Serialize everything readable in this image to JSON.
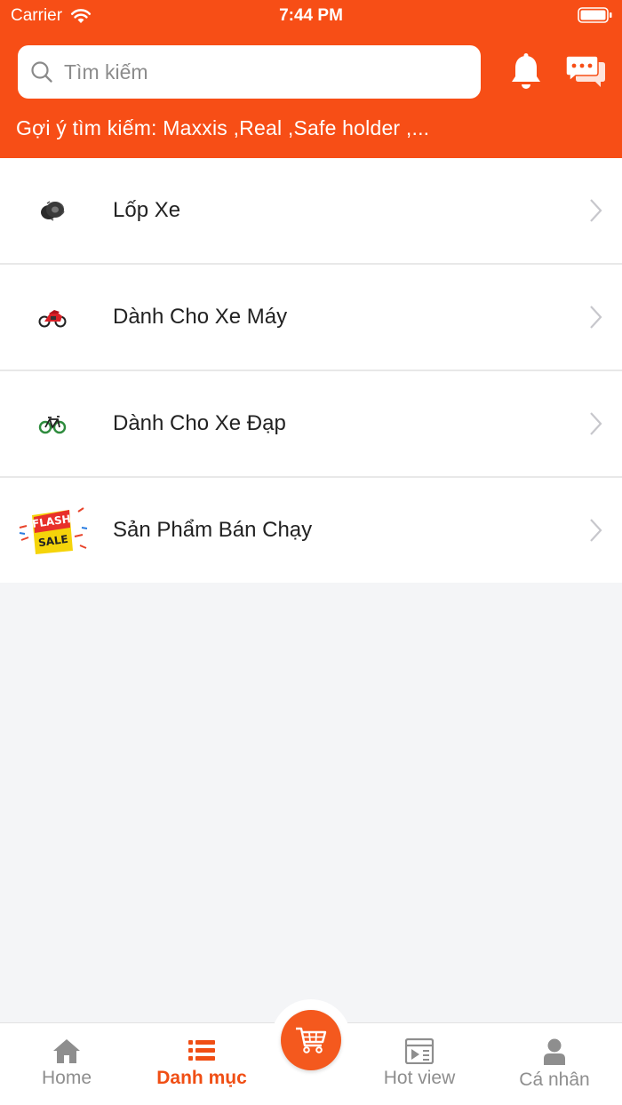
{
  "status_bar": {
    "carrier": "Carrier",
    "time": "7:44 PM"
  },
  "search": {
    "placeholder": "Tìm kiếm",
    "value": ""
  },
  "suggestions": {
    "text": "Gợi ý tìm kiếm: Maxxis ,Real ,Safe holder ,..."
  },
  "categories": [
    {
      "label": "Lốp Xe",
      "icon": "tire-icon"
    },
    {
      "label": "Dành Cho Xe Máy",
      "icon": "motorbike-icon"
    },
    {
      "label": "Dành Cho Xe Đạp",
      "icon": "bicycle-icon"
    },
    {
      "label": "Sản Phẩm Bán Chạy",
      "icon": "flash-sale-icon",
      "badge_line1": "FLASH",
      "badge_line2": "SALE"
    }
  ],
  "tabbar": {
    "home": "Home",
    "categories": "Danh mục",
    "cart": "",
    "hotview": "Hot view",
    "profile": "Cá nhân",
    "active": "categories"
  },
  "colors": {
    "brand": "#f74e16",
    "active_tab": "#f04e14",
    "inactive_tab": "#8e8e8e",
    "background": "#f4f5f7"
  }
}
